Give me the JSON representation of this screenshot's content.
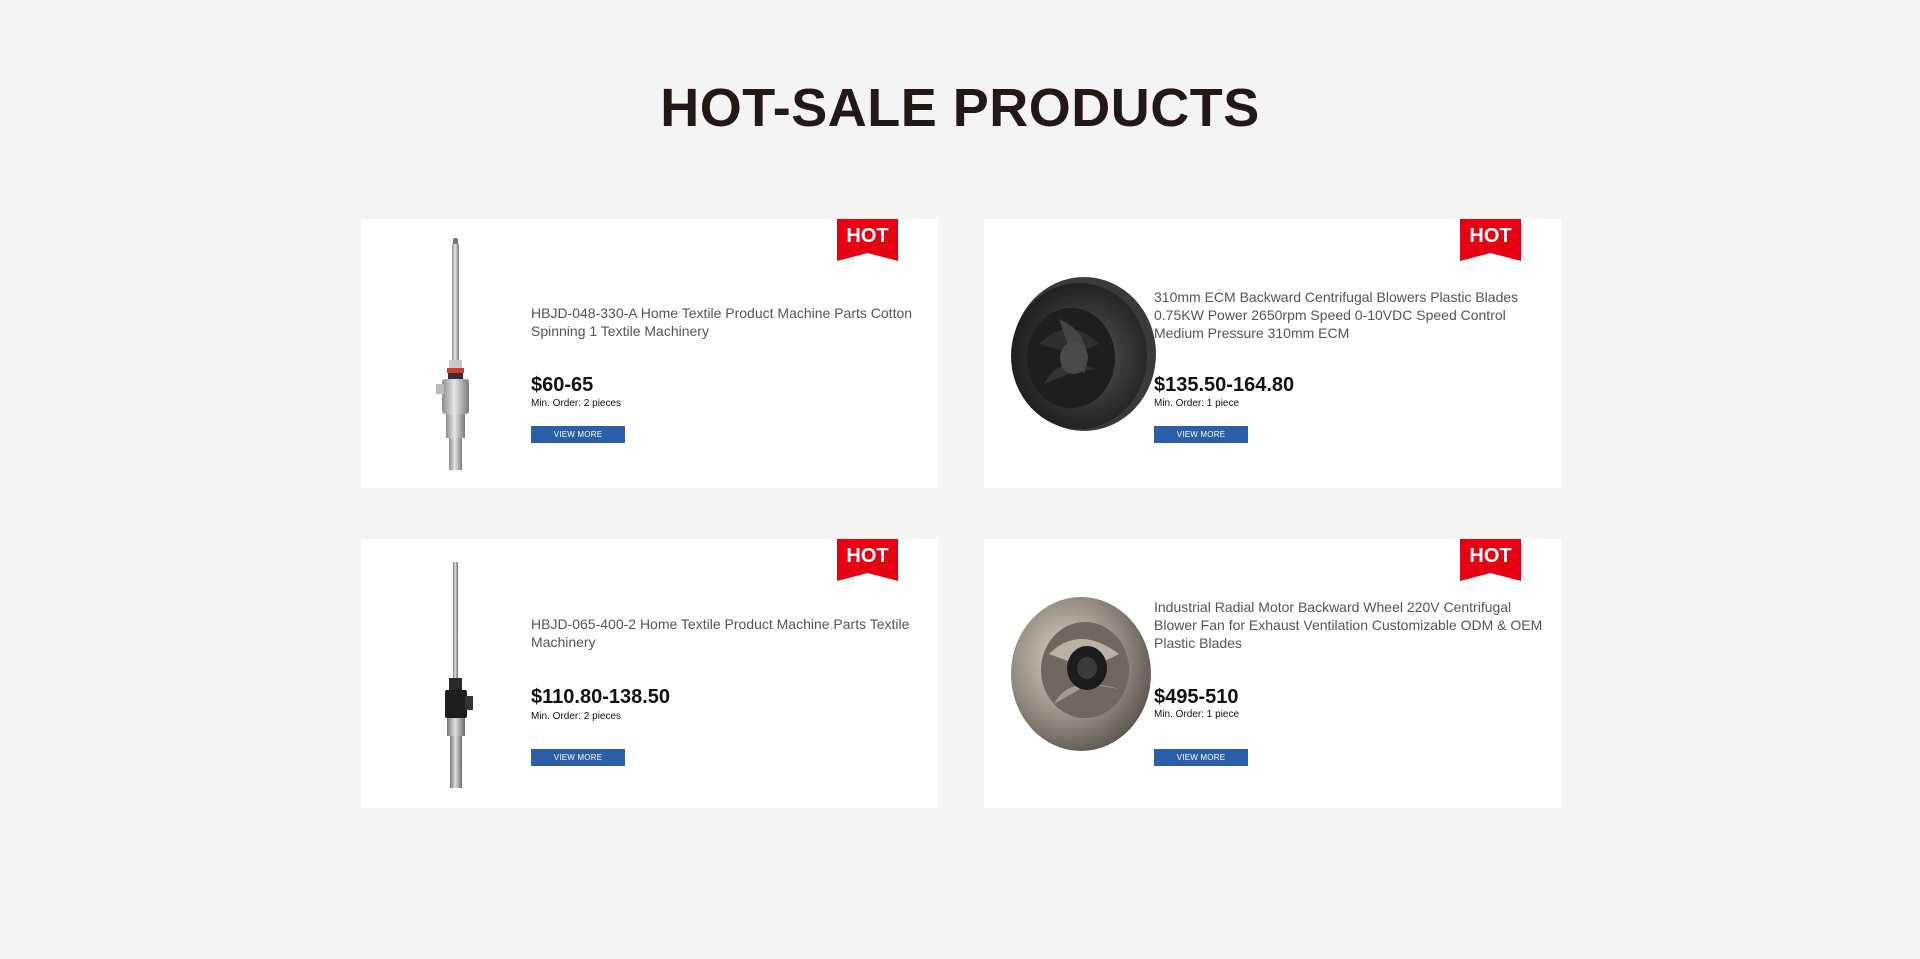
{
  "section": {
    "title": "HOT-SALE PRODUCTS"
  },
  "colors": {
    "background": "#f4f4f4",
    "card": "#ffffff",
    "badge": "#e60012",
    "button": "#2c5fa9",
    "title": "#231815"
  },
  "products": [
    {
      "badge": "HOT",
      "image_icon": "textile-spindle-part-image",
      "title": "HBJD-048-330-A Home Textile Product Machine Parts Cotton Spinning 1 Textile Machinery",
      "price": "$60-65",
      "min_order": "Min. Order: 2 pieces",
      "button_label": "VIEW MORE"
    },
    {
      "badge": "HOT",
      "image_icon": "black-centrifugal-blower-image",
      "title": "310mm ECM Backward Centrifugal Blowers Plastic Blades 0.75KW Power 2650rpm Speed 0-10VDC Speed Control Medium Pressure 310mm ECM",
      "price": "$135.50-164.80",
      "min_order": "Min. Order: 1 piece",
      "button_label": "VIEW MORE"
    },
    {
      "badge": "HOT",
      "image_icon": "textile-spindle-part-image",
      "title": "HBJD-065-400-2 Home Textile Product Machine Parts Textile Machinery",
      "price": "$110.80-138.50",
      "min_order": "Min. Order: 2 pieces",
      "button_label": "VIEW MORE"
    },
    {
      "badge": "HOT",
      "image_icon": "metal-radial-fan-wheel-image",
      "title": "Industrial Radial Motor Backward Wheel 220V Centrifugal Blower Fan for Exhaust Ventilation Customizable ODM & OEM Plastic Blades",
      "price": "$495-510",
      "min_order": "Min. Order: 1 piece",
      "button_label": "VIEW MORE"
    }
  ]
}
